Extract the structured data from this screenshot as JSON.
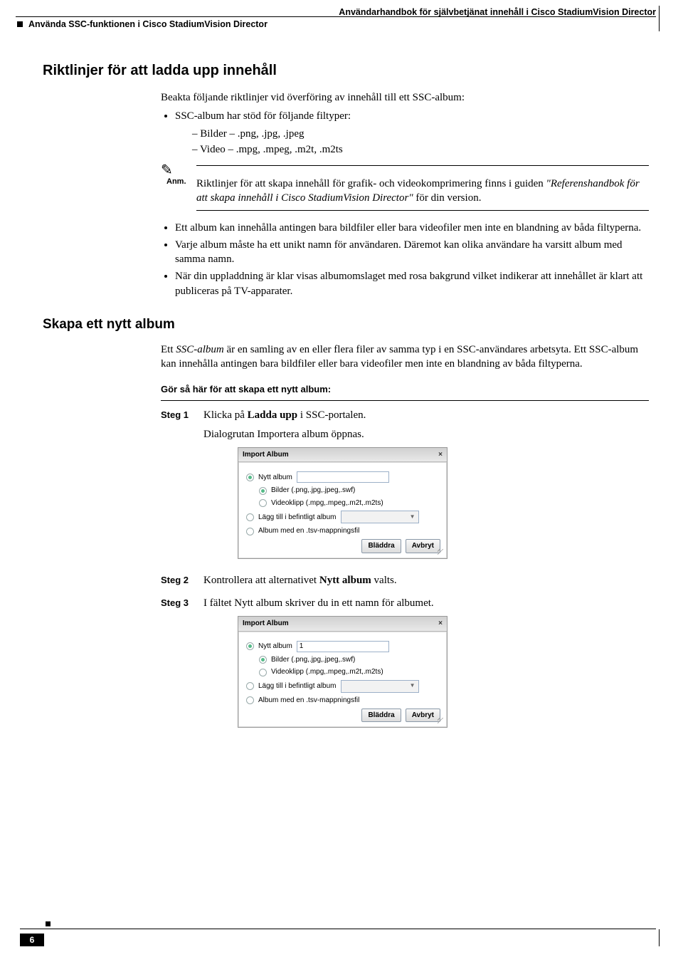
{
  "header": {
    "right": "Användarhandbok för självbetjänat innehåll i Cisco StadiumVision Director",
    "left": "Använda SSC-funktionen i Cisco StadiumVision Director"
  },
  "h1": "Riktlinjer för att ladda upp innehåll",
  "intro": "Beakta följande riktlinjer vid överföring av innehåll till ett SSC-album:",
  "bullet1": "SSC-album har stöd för följande filtyper:",
  "bullet1a": "Bilder – .png, .jpg, .jpeg",
  "bullet1b": "Video – .mpg, .mpeg, .m2t, .m2ts",
  "note_label": "Anm.",
  "note_text1": "Riktlinjer för att skapa innehåll för grafik- och videokomprimering finns i guiden ",
  "note_text_italic": "\"Referenshandbok för att skapa innehåll i Cisco StadiumVision Director\"",
  "note_text2": " för din version.",
  "bullet2": "Ett album kan innehålla antingen bara bildfiler eller bara videofiler men inte en blandning av båda filtyperna.",
  "bullet3": "Varje album måste ha ett unikt namn för användaren. Däremot kan olika användare ha varsitt album med samma namn.",
  "bullet4": "När din uppladdning är klar visas albumomslaget med rosa bakgrund vilket indikerar att innehållet är klart att publiceras på TV-apparater.",
  "h2": "Skapa ett nytt album",
  "desc1a": "Ett ",
  "desc1b": "SSC-album",
  "desc1c": " är en samling av en eller flera filer av samma typ i en SSC-användares arbetsyta. Ett SSC-album kan innehålla antingen bara bildfiler eller bara videofiler men inte en blandning av båda filtyperna.",
  "howto": "Gör så här för att skapa ett nytt album:",
  "steps": {
    "s1_label": "Steg 1",
    "s1a": "Klicka på ",
    "s1b": "Ladda upp",
    "s1c": " i SSC-portalen.",
    "s1_line2": "Dialogrutan Importera album öppnas.",
    "s2_label": "Steg 2",
    "s2a": "Kontrollera att alternativet ",
    "s2b": "Nytt album",
    "s2c": " valts.",
    "s3_label": "Steg 3",
    "s3": "I fältet Nytt album skriver du in ett namn för albumet."
  },
  "dialog": {
    "title": "Import Album",
    "close": "×",
    "opt_new": "Nytt album",
    "opt_images": "Bilder (.png,.jpg,.jpeg,.swf)",
    "opt_video": "Videoklipp (.mpg,.mpeg,.m2t,.m2ts)",
    "opt_existing": "Lägg till i befintligt album",
    "opt_tsv": "Album med en .tsv-mappningsfil",
    "browse": "Bläddra",
    "cancel": "Avbryt",
    "input_value": "1"
  },
  "page_number": "6"
}
